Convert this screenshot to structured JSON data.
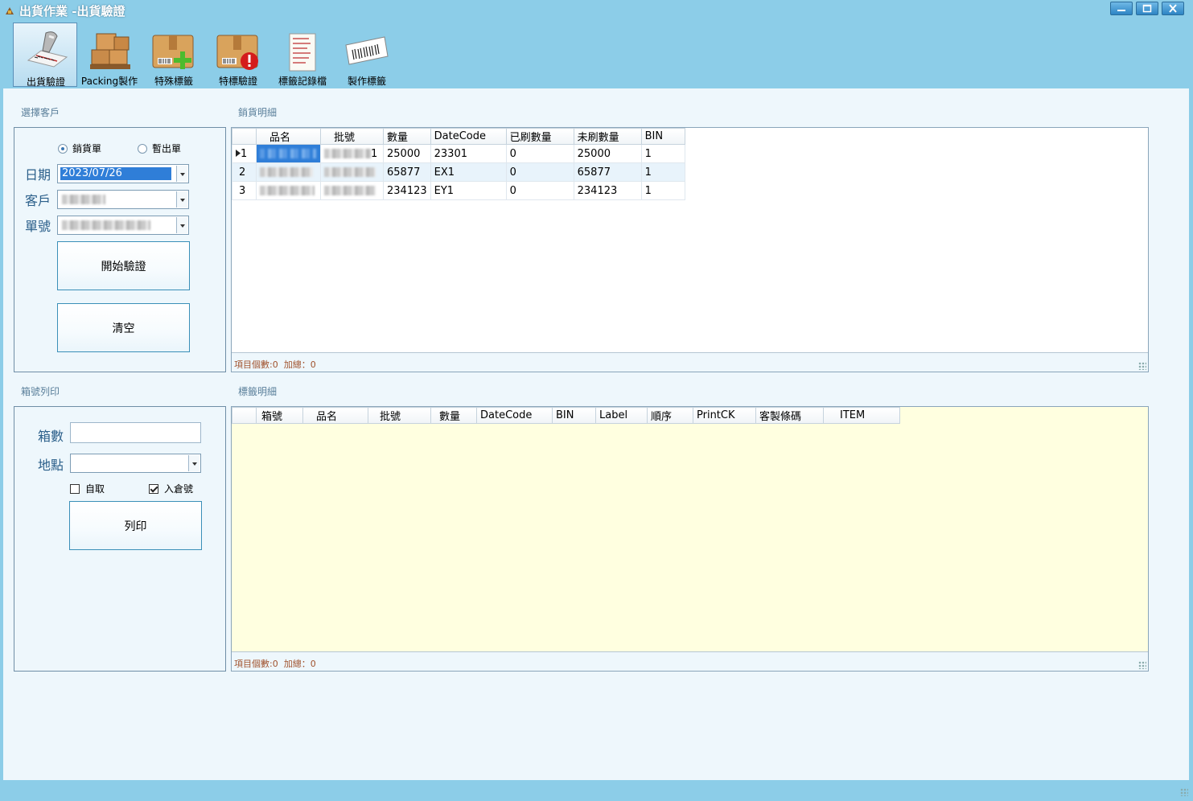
{
  "window": {
    "title": "出貨作業 -出貨驗證",
    "min_icon": "minimize-icon",
    "max_icon": "maximize-icon",
    "close_icon": "close-icon"
  },
  "toolbar": {
    "items": [
      {
        "label": "出貨驗證",
        "icon": "barcode-scanner-icon",
        "active": true
      },
      {
        "label": "Packing製作",
        "icon": "boxes-icon",
        "active": false
      },
      {
        "label": "特殊標籤",
        "icon": "box-add-icon",
        "active": false
      },
      {
        "label": "特標驗證",
        "icon": "box-alert-icon",
        "active": false
      },
      {
        "label": "標籤記錄檔",
        "icon": "label-log-icon",
        "active": false
      },
      {
        "label": "製作標籤",
        "icon": "barcode-label-icon",
        "active": false
      }
    ]
  },
  "customer_group": {
    "title": "選擇客戶",
    "radio_sales": "銷貨單",
    "radio_temp": "暫出單",
    "date_label": "日期",
    "date_value": "2023/07/26",
    "customer_label": "客戶",
    "order_label": "單號",
    "start_button": "開始驗證",
    "clear_button": "清空"
  },
  "sales_detail": {
    "title": "銷貨明細",
    "columns": [
      "品名",
      "批號",
      "數量",
      "DateCode",
      "已刷數量",
      "未刷數量",
      "BIN"
    ],
    "rows": [
      {
        "row_header": "1",
        "lot_suffix": "1",
        "qty": "25000",
        "datecode": "23301",
        "scanned": "0",
        "unscanned": "25000",
        "bin": "1"
      },
      {
        "row_header": "2",
        "lot_suffix": "",
        "qty": "65877",
        "datecode": "EX1",
        "scanned": "0",
        "unscanned": "65877",
        "bin": "1"
      },
      {
        "row_header": "3",
        "lot_suffix": "",
        "qty": "234123",
        "datecode": "EY1",
        "scanned": "0",
        "unscanned": "234123",
        "bin": "1"
      }
    ],
    "footer": "項目個數:0  加總：0"
  },
  "box_print": {
    "title": "箱號列印",
    "box_count_label": "箱數",
    "box_count_value": "",
    "location_label": "地點",
    "location_value": "",
    "self_pickup_label": "自取",
    "self_pickup_checked": false,
    "warehouse_no_label": "入倉號",
    "warehouse_no_checked": true,
    "print_button": "列印"
  },
  "label_detail": {
    "title": "標籤明細",
    "columns": [
      "箱號",
      "品名",
      "批號",
      "數量",
      "DateCode",
      "BIN",
      "Label",
      "順序",
      "PrintCK",
      "客製條碼",
      "ITEM"
    ],
    "footer": "項目個數:0  加總：0"
  },
  "colors": {
    "frame": "#8ccde8",
    "client": "#eef7fc",
    "selection": "#2f7ed8",
    "label_grid_bg": "#ffffe0"
  }
}
